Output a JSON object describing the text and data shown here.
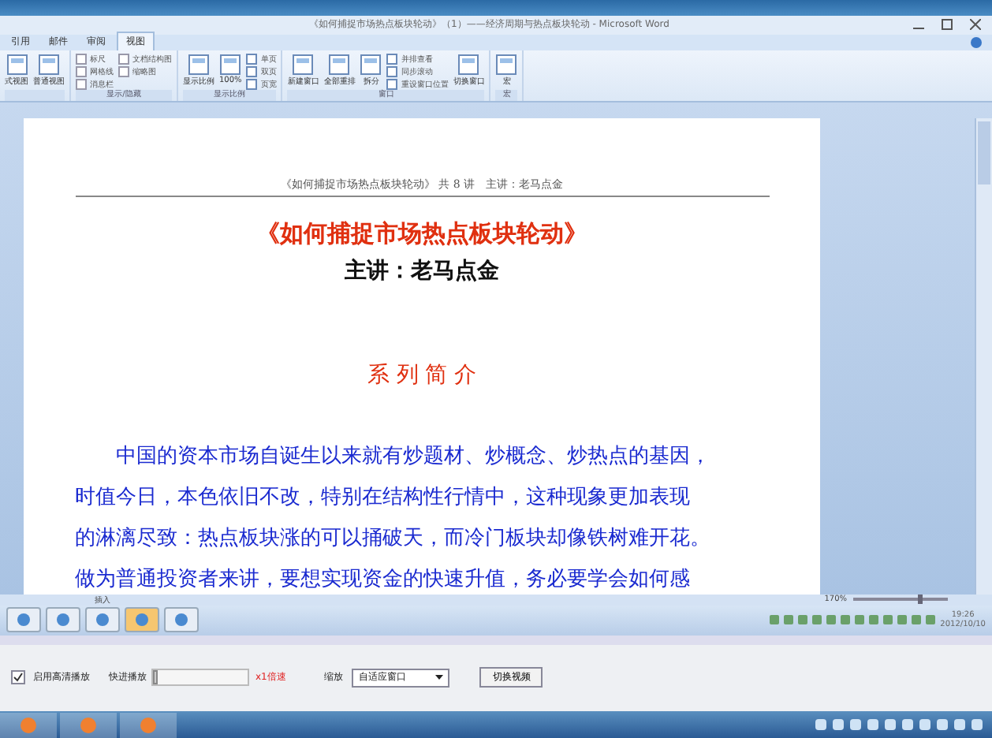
{
  "window": {
    "title": "《如何捕捉市场热点板块轮动》（1）——经济周期与热点板块轮动 - Microsoft Word"
  },
  "tabs": [
    {
      "label": "引用",
      "selected": false
    },
    {
      "label": "邮件",
      "selected": false
    },
    {
      "label": "审阅",
      "selected": false
    },
    {
      "label": "视图",
      "selected": true
    }
  ],
  "ribbon_groups": [
    {
      "items": [
        {
          "kind": "big",
          "label": "式视图"
        },
        {
          "kind": "big",
          "label": "普通视图"
        }
      ]
    },
    {
      "title": "显示/隐藏",
      "items": [
        {
          "kind": "check",
          "label": "标尺",
          "checked": false
        },
        {
          "kind": "check",
          "label": "网格线",
          "checked": false
        },
        {
          "kind": "check",
          "label": "消息栏",
          "checked": false
        },
        {
          "kind": "check",
          "label": "文档结构图",
          "checked": false
        },
        {
          "kind": "check",
          "label": "缩略图",
          "checked": false
        }
      ]
    },
    {
      "title": "显示比例",
      "items": [
        {
          "kind": "big",
          "label": "显示比例"
        },
        {
          "kind": "big",
          "label": "100%"
        },
        {
          "kind": "small",
          "label": "单页"
        },
        {
          "kind": "small",
          "label": "双页"
        },
        {
          "kind": "small",
          "label": "页宽"
        }
      ]
    },
    {
      "title": "窗口",
      "items": [
        {
          "kind": "big",
          "label": "新建窗口"
        },
        {
          "kind": "big",
          "label": "全部重排"
        },
        {
          "kind": "big",
          "label": "拆分"
        },
        {
          "kind": "small",
          "label": "并排查看"
        },
        {
          "kind": "small",
          "label": "同步滚动"
        },
        {
          "kind": "small",
          "label": "重设窗口位置"
        },
        {
          "kind": "big",
          "label": "切换窗口"
        }
      ]
    },
    {
      "title": "宏",
      "items": [
        {
          "kind": "big",
          "label": "宏"
        }
      ]
    }
  ],
  "document": {
    "header": "《如何捕捉市场热点板块轮动》 共 8 讲　主讲：老马点金",
    "title": "《如何捕捉市场热点板块轮动》",
    "subtitle": "主讲：老马点金",
    "section": "系 列 简 介",
    "lines": [
      "中国的资本市场自诞生以来就有炒题材、炒概念、炒热点的基因，",
      "时值今日，本色依旧不改，特别在结构性行情中，这种现象更加表现",
      "的淋漓尽致：热点板块涨的可以捅破天，而冷门板块却像铁树难开花。",
      "做为普通投资者来讲，要想实现资金的快速升值，务必要学会如何感"
    ]
  },
  "status_bar": {
    "mode": "插入",
    "zoom": "170%",
    "zoom_slider": {
      "level": 0.7
    }
  },
  "inner_taskbar": {
    "clock": "19:26",
    "date": "2012/10/10"
  },
  "player": {
    "hd": {
      "label": "启用高清播放",
      "checked": true
    },
    "speed": {
      "label": "快进播放",
      "level": 0,
      "value": "x1倍速"
    },
    "zoom_label": "缩放",
    "zoom_value": "自适应窗口",
    "switch_button": "切换视频"
  }
}
